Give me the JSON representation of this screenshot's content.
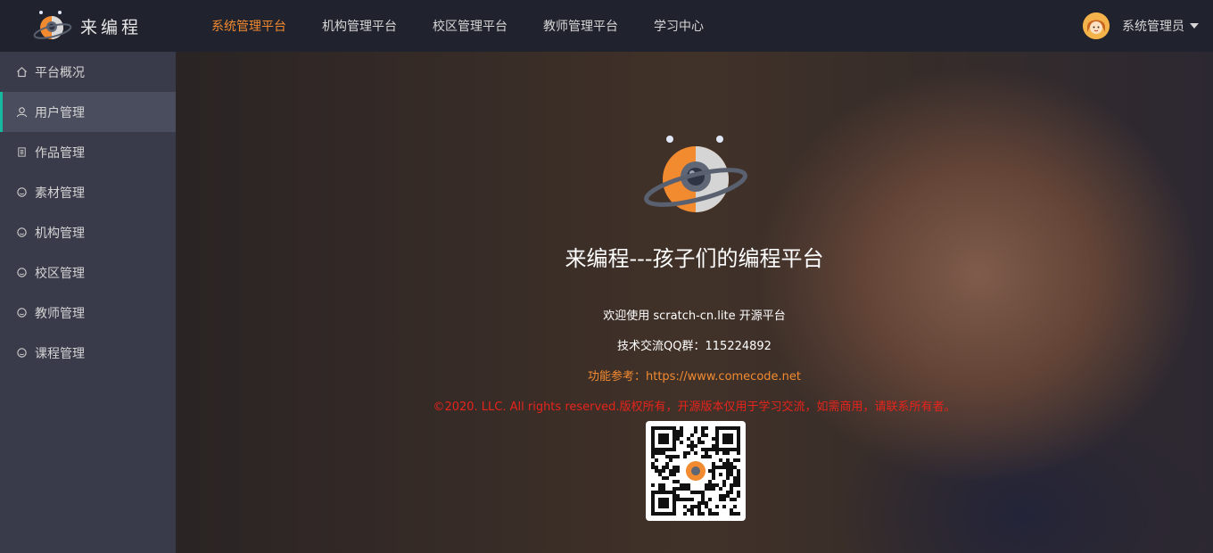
{
  "brand": {
    "name": "来编程"
  },
  "topnav": {
    "items": [
      {
        "label": "系统管理平台",
        "active": true
      },
      {
        "label": "机构管理平台",
        "active": false
      },
      {
        "label": "校区管理平台",
        "active": false
      },
      {
        "label": "教师管理平台",
        "active": false
      },
      {
        "label": "学习中心",
        "active": false
      }
    ]
  },
  "user": {
    "name": "系统管理员",
    "avatar_icon": "user-avatar-icon"
  },
  "sidebar": {
    "items": [
      {
        "label": "平台概况",
        "icon": "home-icon"
      },
      {
        "label": "用户管理",
        "icon": "user-icon",
        "active": true
      },
      {
        "label": "作品管理",
        "icon": "document-icon"
      },
      {
        "label": "素材管理",
        "icon": "circle-icon"
      },
      {
        "label": "机构管理",
        "icon": "circle-icon"
      },
      {
        "label": "校区管理",
        "icon": "circle-icon"
      },
      {
        "label": "教师管理",
        "icon": "circle-icon"
      },
      {
        "label": "课程管理",
        "icon": "circle-icon"
      }
    ]
  },
  "hero": {
    "title": "来编程---孩子们的编程平台",
    "welcome": "欢迎使用 scratch-cn.lite 开源平台",
    "qq_group": "技术交流QQ群：115224892",
    "reference": "功能参考：https://www.comecode.net",
    "copyright": "©2020. LLC. All rights reserved.版权所有，开源版本仅用于学习交流，如需商用，请联系所有者。"
  },
  "colors": {
    "accent": "#f28a30",
    "sidebar_active_marker": "#17b8a0",
    "topbar_bg": "#20222d",
    "sidebar_bg": "#393b4a",
    "copyright": "#e6241c"
  }
}
